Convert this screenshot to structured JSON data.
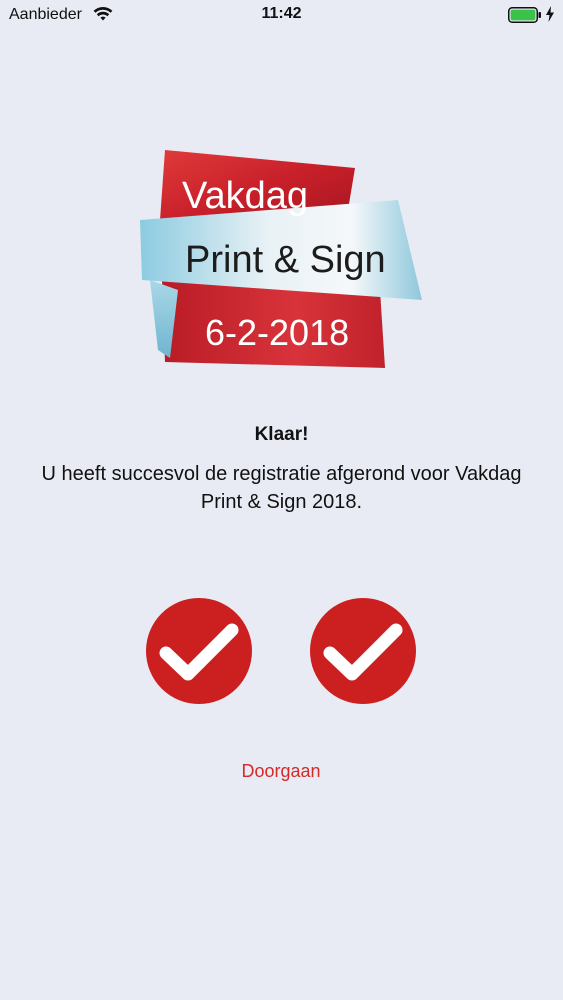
{
  "status_bar": {
    "carrier": "Aanbieder",
    "time": "11:42",
    "battery_level": 1.0,
    "wifi_icon": "wifi-icon",
    "battery_icon": "battery-icon",
    "charging_icon": "charging-bolt-icon"
  },
  "logo": {
    "line1": "Vakdag",
    "line2": "Print & Sign",
    "line3": "6-2-2018"
  },
  "message": {
    "title": "Klaar!",
    "body": "U heeft succesvol de registratie afgerond voor Vakdag Print & Sign 2018."
  },
  "checks": [
    {
      "icon": "checkmark-icon",
      "state": "checked"
    },
    {
      "icon": "checkmark-icon",
      "state": "checked"
    }
  ],
  "continue_button": {
    "label": "Doorgaan"
  },
  "colors": {
    "background": "#e8ebf3",
    "accent_red": "#d42a2a",
    "check_red": "#cc1f1f"
  }
}
